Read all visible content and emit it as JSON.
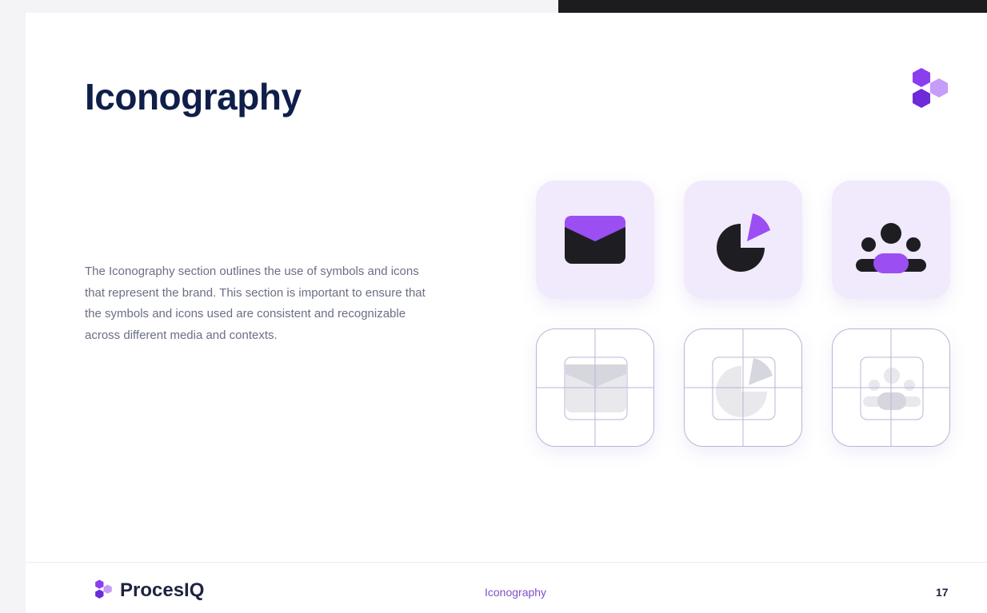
{
  "slide": {
    "title": "Iconography",
    "description": "The Iconography section outlines the use of symbols and icons that represent the brand. This section is important to ensure that the symbols and icons used are consistent and recognizable across different media and contexts."
  },
  "icons": {
    "filled_row": [
      "envelope-icon",
      "pie-chart-icon",
      "team-icon"
    ],
    "grid_row": [
      "envelope-grid-icon",
      "pie-chart-grid-icon",
      "team-grid-icon"
    ]
  },
  "footer": {
    "brand": "ProcesIQ",
    "section": "Iconography",
    "page_number": "17"
  },
  "colors": {
    "title": "#0f1f4a",
    "accent_purple": "#8b3ef0",
    "deep_purple": "#6d2bd9",
    "light_purple": "#b98af7",
    "tile_fill": "#f1e9fc",
    "icon_dark": "#1e1e22"
  }
}
